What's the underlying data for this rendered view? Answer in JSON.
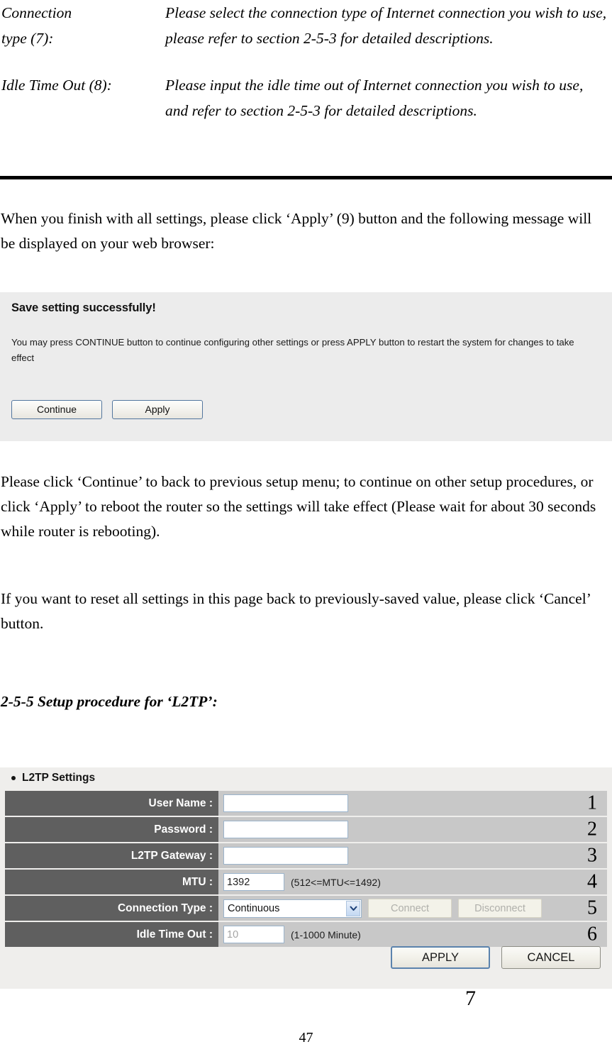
{
  "definitions": [
    {
      "term": "Connection type (7):",
      "term_line1": "Connection",
      "term_line2": "type (7):",
      "description": "Please select the connection type of Internet connection you wish to use, please refer to section 2-5-3 for detailed descriptions."
    },
    {
      "term": "Idle Time Out (8):",
      "description": "Please input the idle time out of Internet connection you wish to use, and refer to section 2-5-3 for detailed descriptions."
    }
  ],
  "paragraphs": {
    "intro": "When you finish with all settings, please click ‘Apply’ (9) button and the following message will be displayed on your web browser:",
    "after_dialog_1": "Please click ‘Continue’ to back to previous setup menu; to continue on other setup procedures, or click ‘Apply’ to reboot the router so the settings will take effect (Please wait for about 30 seconds while router is rebooting).",
    "after_dialog_2": "If you want to reset all settings in this page back to previously-saved value, please click ‘Cancel’ button."
  },
  "save_dialog": {
    "title": "Save setting successfully!",
    "body": "You may press CONTINUE button to continue configuring other settings or press APPLY button to restart the system for changes to take effect",
    "buttons": {
      "continue": "Continue",
      "apply": "Apply"
    },
    "background_color": "#ececec"
  },
  "section_heading": "2-5-5 Setup procedure for ‘L2TP’:",
  "l2tp_panel": {
    "header": "L2TP Settings",
    "background_color": "#efeeec",
    "label_color": "#5f5f5f",
    "field_color": "#c8c8c8",
    "rows": [
      {
        "label": "User Name :",
        "value": "",
        "hint": "",
        "callout": "1",
        "control": "text"
      },
      {
        "label": "Password :",
        "value": "",
        "hint": "",
        "callout": "2",
        "control": "text"
      },
      {
        "label": "L2TP Gateway :",
        "value": "",
        "hint": "",
        "callout": "3",
        "control": "text"
      },
      {
        "label": "MTU :",
        "value": "1392",
        "hint": "(512<=MTU<=1492)",
        "callout": "4",
        "control": "number"
      },
      {
        "label": "Connection Type :",
        "value": "Continuous",
        "hint": "",
        "callout": "5",
        "control": "select",
        "connect_label": "Connect",
        "disconnect_label": "Disconnect"
      },
      {
        "label": "Idle Time Out :",
        "value": "10",
        "hint": "(1-1000 Minute)",
        "callout": "6",
        "control": "number-disabled"
      }
    ],
    "actions": {
      "apply": "APPLY",
      "cancel": "CANCEL"
    },
    "actions_callout": "7"
  },
  "page_number": "47"
}
